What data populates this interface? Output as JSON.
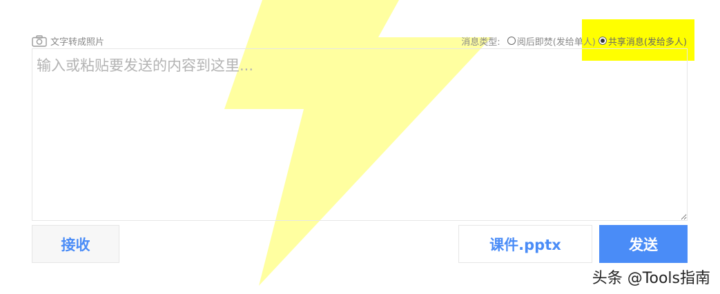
{
  "toolbar": {
    "text_to_photo_label": "文字转成照片",
    "camera_icon": "camera-icon"
  },
  "message_type": {
    "label": "消息类型:",
    "options": [
      {
        "label": "阅后即焚(发给单人)",
        "checked": false
      },
      {
        "label": "共享消息(发给多人)",
        "checked": true
      }
    ],
    "highlight_color": "#ffff00"
  },
  "editor": {
    "placeholder": "输入或粘贴要发送的内容到这里...",
    "value": ""
  },
  "buttons": {
    "receive_label": "接收",
    "file_label": "课件.pptx",
    "send_label": "发送"
  },
  "colors": {
    "accent": "#4a8cf7",
    "bolt": "#ffff66"
  },
  "watermark": "头条 @Tools指南"
}
